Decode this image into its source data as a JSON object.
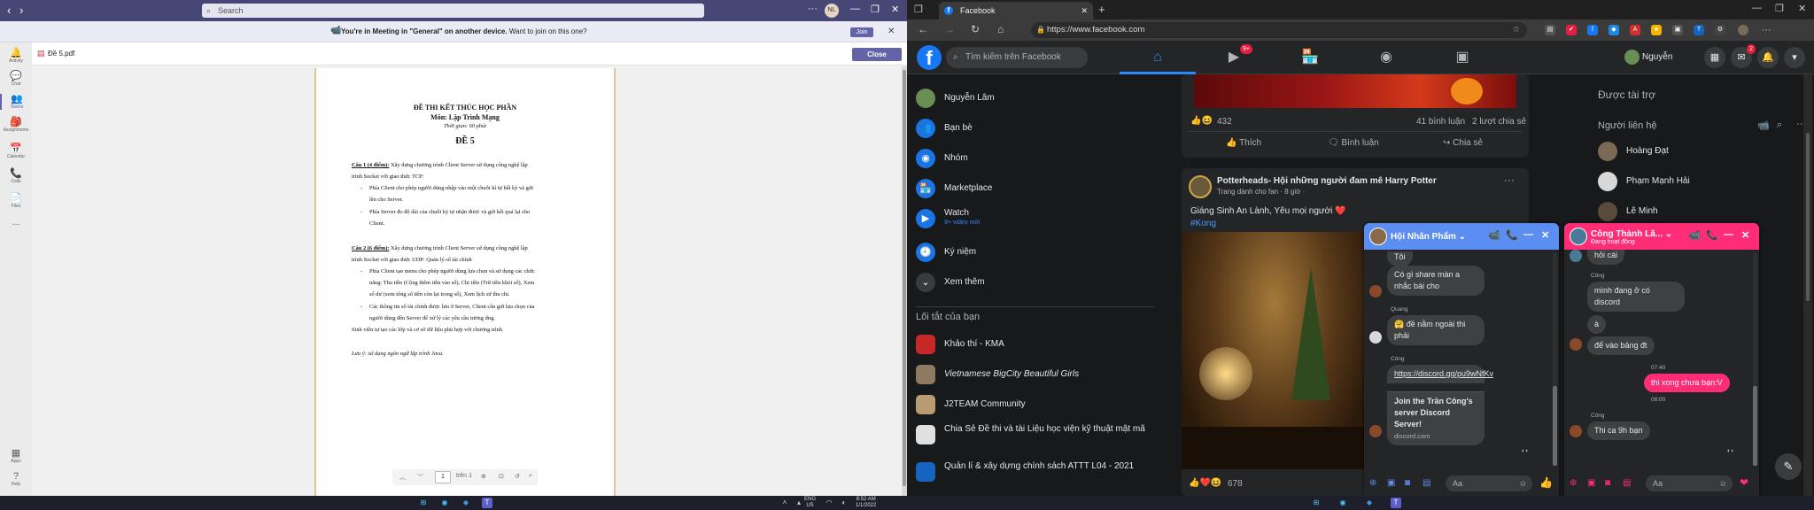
{
  "teams": {
    "search_placeholder": "Search",
    "avatar_initials": "NL",
    "banner_text_bold": "You're in Meeting in \"General\" on another device.",
    "banner_text_rest": " Want to join on this one?",
    "join_label": "Join",
    "rail": [
      {
        "label": "Activity",
        "icon": "bell-icon"
      },
      {
        "label": "Chat",
        "icon": "chat-icon"
      },
      {
        "label": "Teams",
        "icon": "teams-icon"
      },
      {
        "label": "Assignments",
        "icon": "assignments-icon"
      },
      {
        "label": "Calendar",
        "icon": "calendar-icon"
      },
      {
        "label": "Calls",
        "icon": "phone-icon"
      },
      {
        "label": "Files",
        "icon": "file-icon"
      },
      {
        "label": "...",
        "icon": "more-icon"
      },
      {
        "label": "Apps",
        "icon": "apps-icon"
      },
      {
        "label": "Help",
        "icon": "help-icon"
      }
    ],
    "file_name": "Đề 5.pdf",
    "close_label": "Close",
    "doc": {
      "title": "ĐỀ THI KẾT THÚC HỌC PHẦN",
      "subject": "Môn: Lập Trình Mạng",
      "time": "Thời gian: 60 phút",
      "code": "ĐỀ 5",
      "q1_head": "Câu 1 (4 điểm):",
      "q1_l1": " Xây dựng chương trình Client Server sử dụng công nghệ lập",
      "q1_l2": "trình Socket với giao thức TCP:",
      "q1_b1a": "Phía Client cho phép người dùng nhập vào một chuỗi kí tự bất kỳ và gửi",
      "q1_b1b": "lên cho Server.",
      "q1_b2a": "Phía Server đo độ dài của chuỗi ký tự nhận được và gửi kết quả lại cho",
      "q1_b2b": "Client.",
      "q2_head": "Câu 2 (6 điểm):",
      "q2_l1": " Xây dựng chương trình Client Server sử dụng công nghệ lập",
      "q2_l2": "trình Socket với giao thức UDP: Quản lý sổ tài chính",
      "q2_b1a": "Phía Client tạo menu cho phép người dùng lựa chọn và sử dụng các chức",
      "q2_b1b": "năng: Thu tiền (Cộng thêm tiền vào số), Chi tiền (Trừ tiền khỏi số), Xem",
      "q2_b1c": "số dư (xem tổng số tiền còn lại trong số), Xem lịch sử thu chi.",
      "q2_b2a": "Các thông tin số tài chính được lưu ở Server, Client cần gửi lựa chọn của",
      "q2_b2b": "người dùng đến Server để xử lý các yêu cầu tương ứng.",
      "note1": "Sinh viên tự tạo các lớp và cơ sở dữ liệu phù hợp với chương trình.",
      "note2": "Lưu ý: sử dụng ngôn ngữ lập trình Java."
    },
    "pager": {
      "page": "1",
      "total": "trên 1"
    }
  },
  "browser": {
    "tab_title": "Facebook",
    "url": "https://www.facebook.com"
  },
  "fb": {
    "search_placeholder": "Tìm kiếm trên Facebook",
    "watch_badge": "9+",
    "profile_name": "Nguyễn",
    "messenger_badge": "2",
    "left_menu": [
      {
        "label": "Nguyễn Lâm"
      },
      {
        "label": "Bạn bè"
      },
      {
        "label": "Nhóm"
      },
      {
        "label": "Marketplace"
      },
      {
        "label": "Watch",
        "sub": "9+ video mới"
      },
      {
        "label": "Ký niệm"
      },
      {
        "label": "Xem thêm"
      }
    ],
    "shortcuts_title": "Lối tắt của bạn",
    "shortcuts": [
      {
        "label": "Khảo thí - KMA"
      },
      {
        "label": "Vietnamese BigCity Beautiful Girls"
      },
      {
        "label": "J2TEAM Community"
      },
      {
        "label": "Chia Sẻ Đề thi và tài Liệu học viện kỹ thuật mật mã"
      },
      {
        "label": "Quản lí & xây dựng chính sách ATTT L04 - 2021"
      }
    ],
    "post1": {
      "reactions": "432",
      "comments": "41 bình luận",
      "shares": "2 lượt chia sẻ",
      "like": "Thích",
      "comment": "Bình luận",
      "share": "Chia sẻ"
    },
    "post2": {
      "page": "Potterheads- Hội những người đam mê Harry Potter",
      "meta": "Trang dành cho fan · 8 giờ ·",
      "text": "Giáng Sinh An Lành, Yêu mọi người ❤️",
      "tag": "#Kong",
      "reactions": "678"
    },
    "sponsored": "Được tài trợ",
    "contacts_title": "Người liên hệ",
    "contacts": [
      {
        "name": "Hoàng Đạt"
      },
      {
        "name": "Phạm Mạnh Hải"
      },
      {
        "name": "Lê Minh"
      }
    ],
    "chat1": {
      "name": "Hội Nhân Phẩm",
      "color": "#5b8ef0",
      "msgs": {
        "m0": "Tôi",
        "m1": "Có gì share màn a nhắc bài cho",
        "s2": "Quang",
        "m2": "🤗 đề nằm ngoài thi phải",
        "s3": "Công",
        "link": "https://discord.gg/pu9wNfKv",
        "card_title": "Join the Trần Công's server Discord Server!",
        "card_domain": "discord.com"
      },
      "input": "Aa"
    },
    "chat2": {
      "name": "Công Thành Lă...",
      "status": "Đang hoạt động",
      "color": "#ff2d78",
      "msgs": {
        "m0": "hỏi cái",
        "s1": "Công",
        "m1": "mình đang ở có discord",
        "m2": "à",
        "m3": "để vào bảng đt",
        "t1": "07:40",
        "m4": "thi xong chưa bạn:V",
        "t2": "08:00",
        "s5": "Công",
        "m5": "Thi ca 9h bạn"
      },
      "input": "Aa"
    }
  },
  "taskbar": {
    "lang1": "ENG",
    "lang2": "US",
    "time": "8:52 AM",
    "date": "1/1/2022"
  }
}
